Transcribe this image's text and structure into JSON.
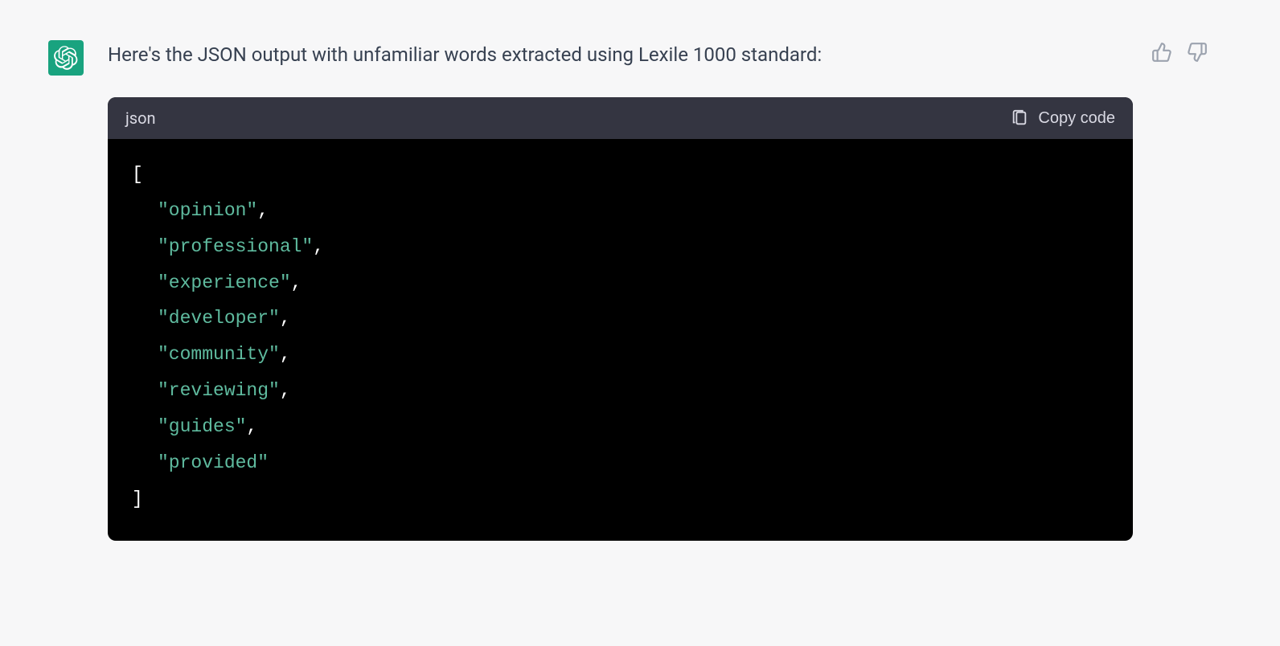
{
  "message": {
    "intro_text": "Here's the JSON output with unfamiliar words extracted using Lexile 1000 standard:"
  },
  "code_block": {
    "language": "json",
    "copy_label": "Copy code",
    "words": [
      "opinion",
      "professional",
      "experience",
      "developer",
      "community",
      "reviewing",
      "guides",
      "provided"
    ]
  }
}
